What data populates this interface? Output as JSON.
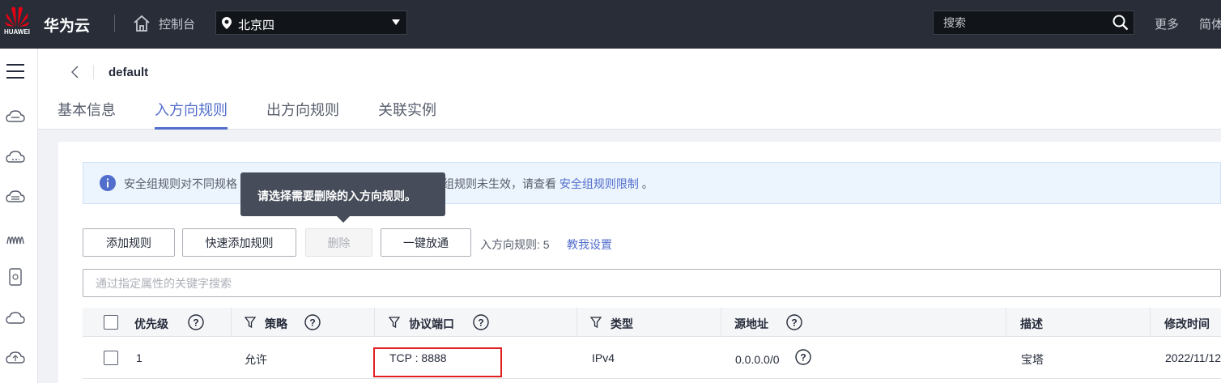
{
  "topbar": {
    "logo_text": "HUAWEI",
    "brand": "华为云",
    "console": "控制台",
    "region": "北京四",
    "search_placeholder": "搜索",
    "more": "更多",
    "lang": "简体"
  },
  "header": {
    "title": "default",
    "tabs": [
      {
        "label": "基本信息",
        "active": false
      },
      {
        "label": "入方向规则",
        "active": true
      },
      {
        "label": "出方向规则",
        "active": false
      },
      {
        "label": "关联实例",
        "active": false
      }
    ]
  },
  "notice": {
    "text_start": "安全组规则对不同规格",
    "text_end": "安全组规则未生效，请查看",
    "link": "安全组规则限制",
    "suffix": "。"
  },
  "tooltip": "请选择需要删除的入方向规则。",
  "toolbar": {
    "add": "添加规则",
    "quick_add": "快速添加规则",
    "delete": "删除",
    "allow_all": "一键放通",
    "count_label": "入方向规则: 5",
    "howto": "教我设置"
  },
  "filter_placeholder": "通过指定属性的关键字搜索",
  "table": {
    "columns": [
      "优先级",
      "策略",
      "协议端口",
      "类型",
      "源地址",
      "描述",
      "修改时间"
    ],
    "rows": [
      {
        "priority": "1",
        "policy": "允许",
        "port": "TCP : 8888",
        "type": "IPv4",
        "source": "0.0.0.0/0",
        "desc": "宝塔",
        "modified": "2022/11/12"
      }
    ]
  },
  "colors": {
    "topbar": "#282d38",
    "accent": "#526ecc",
    "highlight": "#e02020"
  }
}
